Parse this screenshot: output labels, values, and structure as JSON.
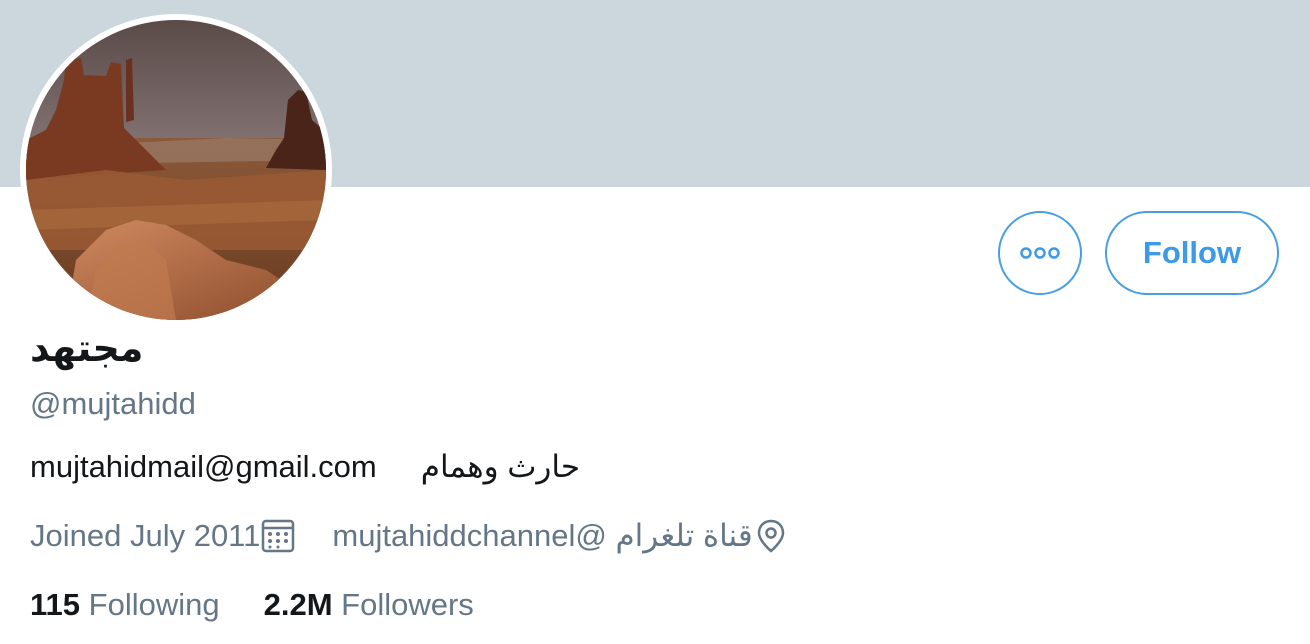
{
  "profile": {
    "name": "مجتهد",
    "handle": "@mujtahidd",
    "bio_email": "mujtahidmail@gmail.com",
    "bio_text": "حارث وهمام",
    "joined": "Joined July 2011",
    "location": "قناة تلغرام @mujtahiddchannel"
  },
  "actions": {
    "follow_label": "Follow",
    "more_icon": "more-horizontal-icon"
  },
  "stats": {
    "following_count": "115",
    "following_label": "Following",
    "followers_count": "2.2M",
    "followers_label": "Followers"
  },
  "colors": {
    "banner": "#ccd6dd",
    "accent": "#4a9fe0",
    "text_primary": "#14171a",
    "text_secondary": "#657786"
  }
}
